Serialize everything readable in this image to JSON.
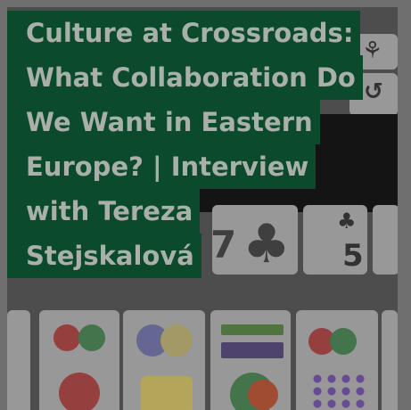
{
  "headline": {
    "lines": [
      "Culture at Crossroads:",
      "What Collaboration Do",
      "We Want in Eastern",
      "Europe? | Interview",
      "with Tereza",
      "Stejskalová"
    ]
  },
  "photo": {
    "symbols": [
      "⚘",
      "↺",
      "♣",
      "7",
      "5"
    ]
  }
}
